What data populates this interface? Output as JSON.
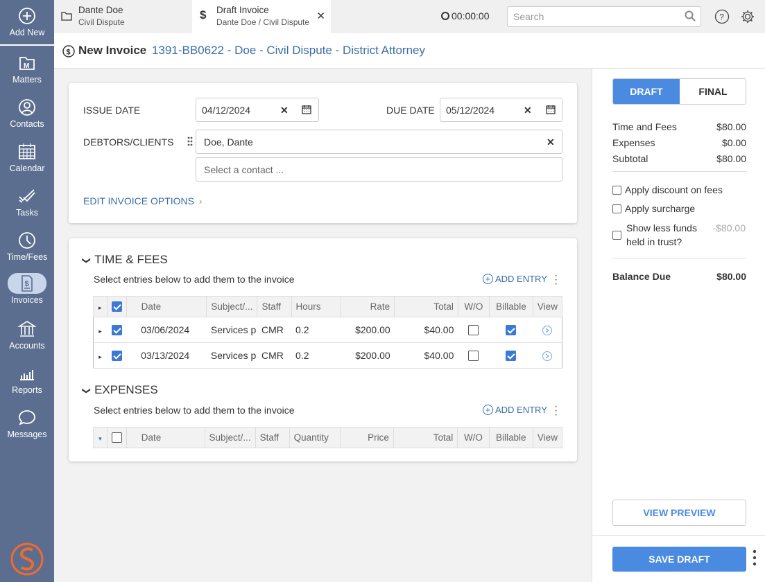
{
  "sidebar": {
    "add_new": "Add New",
    "items": [
      {
        "label": "Matters"
      },
      {
        "label": "Contacts"
      },
      {
        "label": "Calendar"
      },
      {
        "label": "Tasks"
      },
      {
        "label": "Time/Fees"
      },
      {
        "label": "Invoices"
      },
      {
        "label": "Accounts"
      },
      {
        "label": "Reports"
      },
      {
        "label": "Messages"
      }
    ]
  },
  "tabs": [
    {
      "title": "Dante Doe",
      "subtitle": "Civil Dispute"
    },
    {
      "title": "Draft Invoice",
      "subtitle": "Dante Doe / Civil Dispute"
    }
  ],
  "timer": "00:00:00",
  "search": {
    "placeholder": "Search"
  },
  "header": {
    "title": "New Invoice",
    "matter_link": "1391-BB0622 - Doe - Civil Dispute - District Attorney"
  },
  "invoice_form": {
    "issue_date_label": "ISSUE DATE",
    "issue_date": "04/12/2024",
    "due_date_label": "DUE DATE",
    "due_date": "05/12/2024",
    "debtors_label": "DEBTORS/CLIENTS",
    "debtor": "Doe, Dante",
    "contact_placeholder": "Select a contact ...",
    "edit_options": "EDIT INVOICE OPTIONS"
  },
  "time_fees": {
    "title": "TIME & FEES",
    "subtitle": "Select entries below to add them to the invoice",
    "add_entry": "ADD ENTRY",
    "columns": [
      "Date",
      "Subject/...",
      "Staff",
      "Hours",
      "Rate",
      "Total",
      "W/O",
      "Billable",
      "View"
    ],
    "rows": [
      {
        "date": "03/06/2024",
        "subject": "Services p",
        "staff": "CMR",
        "hours": "0.2",
        "rate": "$200.00",
        "total": "$40.00",
        "selected": true,
        "wo": false,
        "billable": true
      },
      {
        "date": "03/13/2024",
        "subject": "Services p",
        "staff": "CMR",
        "hours": "0.2",
        "rate": "$200.00",
        "total": "$40.00",
        "selected": true,
        "wo": false,
        "billable": true
      }
    ]
  },
  "expenses": {
    "title": "EXPENSES",
    "subtitle": "Select entries below to add them to the invoice",
    "add_entry": "ADD ENTRY",
    "columns": [
      "Date",
      "Subject/...",
      "Staff",
      "Quantity",
      "Price",
      "Total",
      "W/O",
      "Billable",
      "View"
    ]
  },
  "summary": {
    "toggle": {
      "draft": "DRAFT",
      "final": "FINAL",
      "selected": "DRAFT"
    },
    "time_fees_label": "Time and Fees",
    "time_fees_value": "$80.00",
    "expenses_label": "Expenses",
    "expenses_value": "$0.00",
    "subtotal_label": "Subtotal",
    "subtotal_value": "$80.00",
    "discount_label": "Apply discount on fees",
    "surcharge_label": "Apply surcharge",
    "trust_label_1": "Show less funds",
    "trust_label_2": "held in trust?",
    "trust_value": "-$80.00",
    "balance_label": "Balance Due",
    "balance_value": "$80.00",
    "preview_button": "VIEW PREVIEW",
    "save_button": "SAVE DRAFT"
  },
  "colors": {
    "sidebar": "#5b6e8f",
    "accent": "#4a8ae0",
    "link": "#3a6ea5"
  }
}
